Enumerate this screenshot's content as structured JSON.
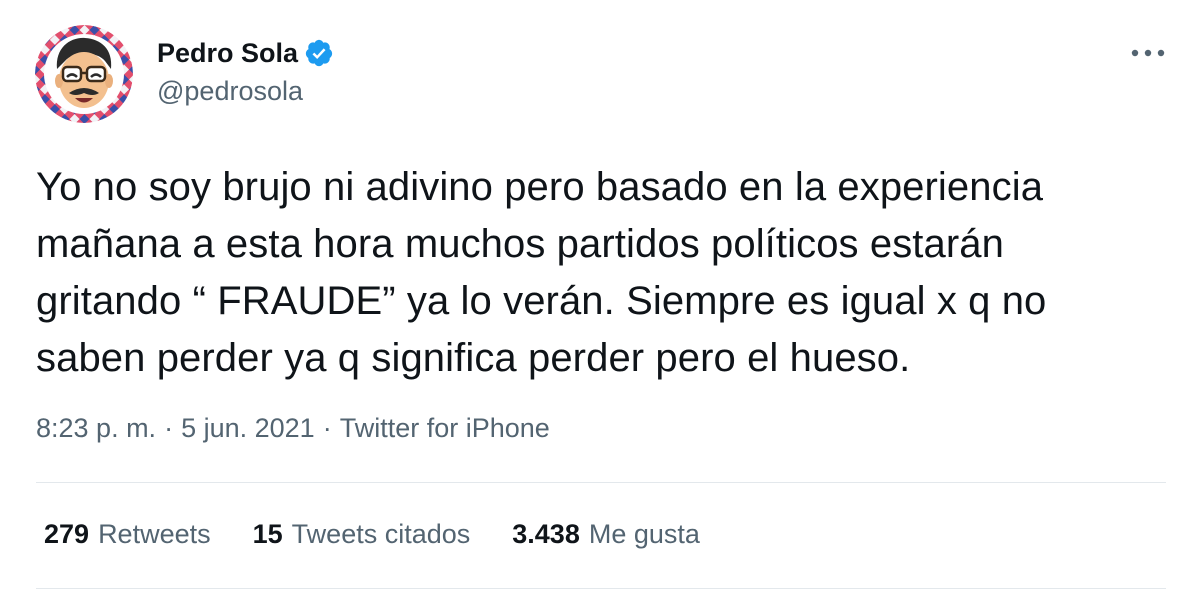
{
  "tweet": {
    "author": {
      "display_name": "Pedro Sola",
      "handle": "@pedrosola",
      "verified": true,
      "verified_color": "#1d9bf0",
      "avatar_icon": "cartoon-avatar-icon"
    },
    "more_icon": "more-options-icon",
    "text": "Yo no soy brujo ni adivino pero basado en la experiencia\nmañana a esta hora muchos partidos políticos estarán\ngritando “ FRAUDE” ya lo verán. Siempre es igual x q no\nsaben perder ya q significa perder pero el hueso.",
    "time": "8:23 p. m.",
    "separator": "·",
    "date": "5 jun. 2021",
    "source": "Twitter for iPhone",
    "stats": {
      "retweets": {
        "count": "279",
        "label": "Retweets"
      },
      "quotes": {
        "count": "15",
        "label": "Tweets citados"
      },
      "likes": {
        "count": "3.438",
        "label": "Me gusta"
      }
    }
  },
  "colors": {
    "text_primary": "#0f1419",
    "text_secondary": "#536471",
    "divider": "#e3e8ec"
  }
}
